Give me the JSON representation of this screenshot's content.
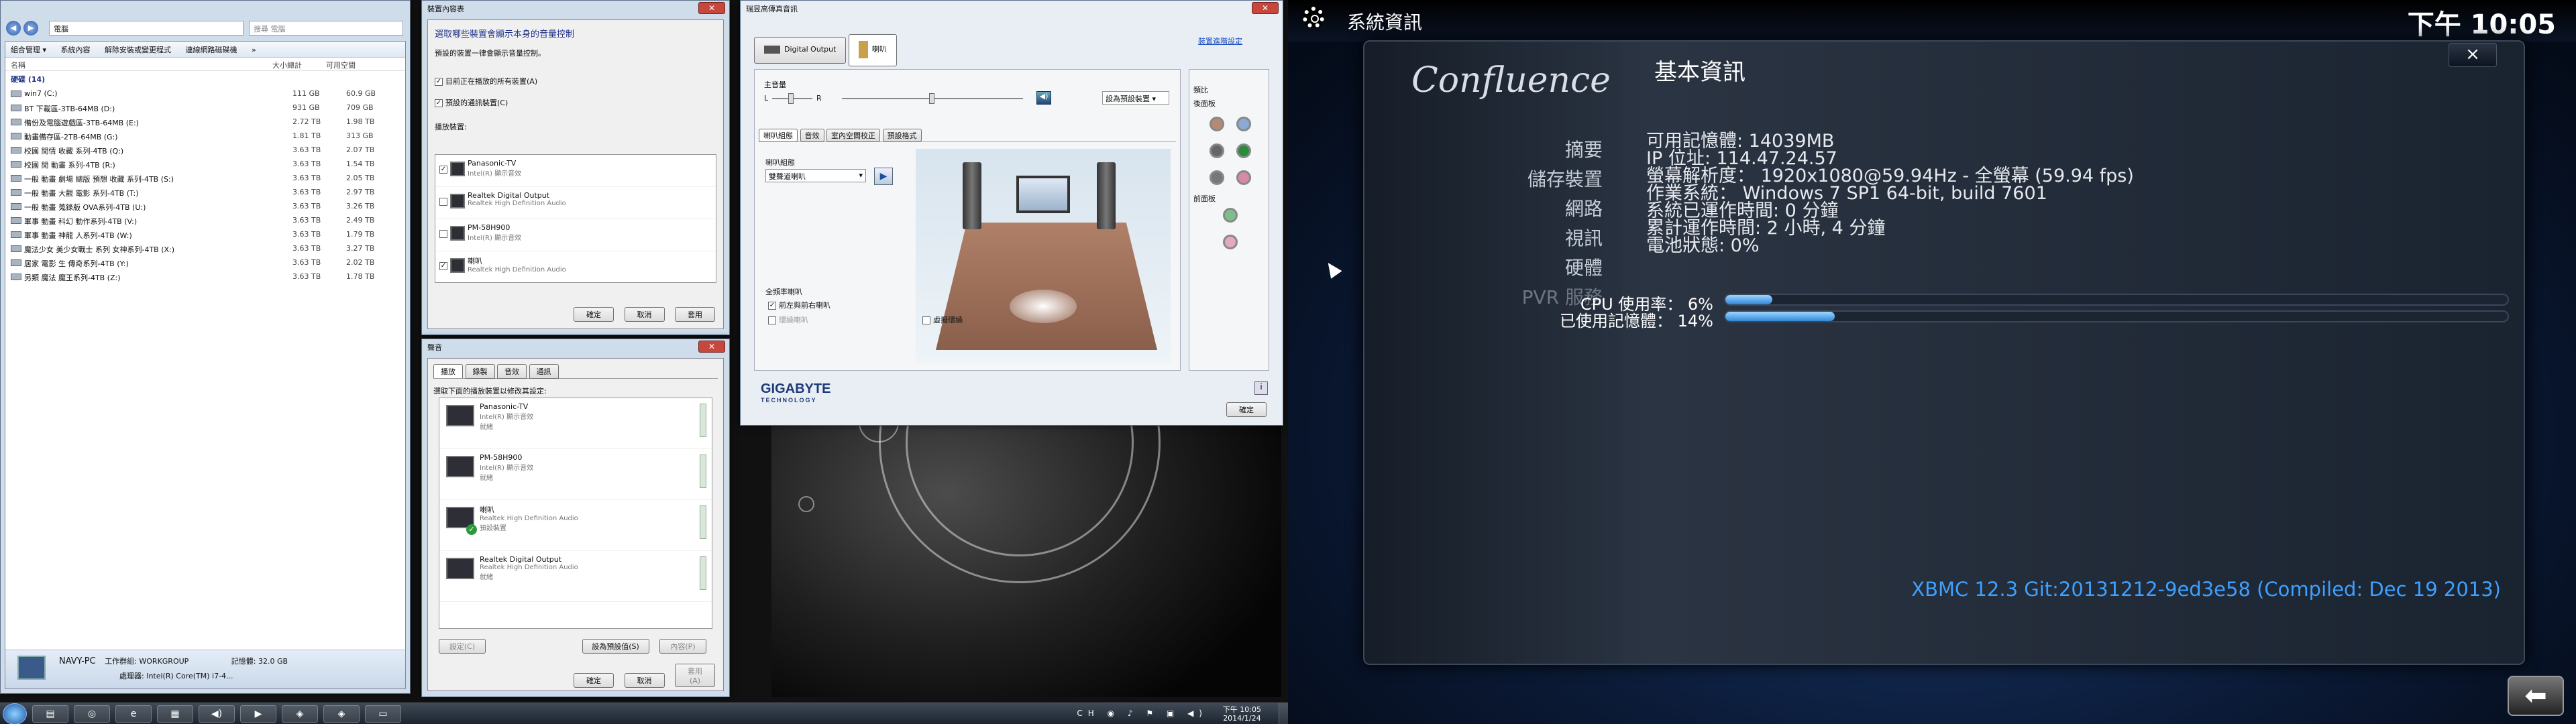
{
  "left": {
    "explorer": {
      "address": "電腦",
      "search_placeholder": "搜尋 電腦",
      "toolbar": [
        "組合管理 ▾",
        "系統內容",
        "解除安裝或變更程式",
        "連線網路磁碟機",
        "»"
      ],
      "columns": [
        "名稱",
        "大小總計",
        "可用空間"
      ],
      "group_label": "硬碟 (14)",
      "drives": [
        {
          "name": "win7 (C:)",
          "total": "111 GB",
          "free": "60.9 GB"
        },
        {
          "name": "BT 下載區-3TB-64MB (D:)",
          "total": "931 GB",
          "free": "709 GB"
        },
        {
          "name": "備份及電腦遊戲區-3TB-64MB (E:)",
          "total": "2.72 TB",
          "free": "1.98 TB"
        },
        {
          "name": "動畫備存區-2TB-64MB (G:)",
          "total": "1.81 TB",
          "free": "313 GB"
        },
        {
          "name": "校園 閒情 收藏 系列-4TB (Q:)",
          "total": "3.63 TB",
          "free": "2.07 TB"
        },
        {
          "name": "校園 閒 動畫 系列-4TB (R:)",
          "total": "3.63 TB",
          "free": "1.54 TB"
        },
        {
          "name": "一般 動畫 劇場 總版 預想 收藏 系列-4TB (S:)",
          "total": "3.63 TB",
          "free": "2.05 TB"
        },
        {
          "name": "一般 動畫 大觀 電影 系列-4TB (T:)",
          "total": "3.63 TB",
          "free": "2.97 TB"
        },
        {
          "name": "一般 動畫 蒐錄版 OVA系列-4TB (U:)",
          "total": "3.63 TB",
          "free": "3.26 TB"
        },
        {
          "name": "軍事 動畫 科幻 動作系列-4TB (V:)",
          "total": "3.63 TB",
          "free": "2.49 TB"
        },
        {
          "name": "軍事 動畫 神龍 人系列-4TB (W:)",
          "total": "3.63 TB",
          "free": "1.79 TB"
        },
        {
          "name": "魔法少女 美少女戰士 系列 女神系列-4TB (X:)",
          "total": "3.63 TB",
          "free": "3.27 TB"
        },
        {
          "name": "居家 電影 生 傳奇系列-4TB (Y:)",
          "total": "3.63 TB",
          "free": "2.02 TB"
        },
        {
          "name": "另類 魔法 魔王系列-4TB (Z:)",
          "total": "3.63 TB",
          "free": "1.78 TB"
        }
      ],
      "status_pc": "NAVY-PC",
      "status_workgroup": "工作群組: WORKGROUP",
      "status_memory": "記憶體: 32.0 GB",
      "status_cpu": "處理器: Intel(R) Core(TM) i7-4..."
    },
    "volmix": {
      "title": "裝置內容表",
      "heading": "選取哪些裝置會顯示本身的音量控制",
      "desc": "預設的裝置一律會顯示音量控制。",
      "check1": "目前正在播放的所有裝置(A)",
      "check2": "預設的通訊裝置(C)",
      "list_label": "播放裝置:",
      "devices": [
        {
          "name": "Panasonic-TV",
          "sub": "Intel(R) 顯示音效"
        },
        {
          "name": "Realtek Digital Output",
          "sub": "Realtek High Definition Audio"
        },
        {
          "name": "PM-58H900",
          "sub": "Intel(R) 顯示音效"
        },
        {
          "name": "喇叭",
          "sub": "Realtek High Definition Audio"
        }
      ],
      "buttons": [
        "確定",
        "取消",
        "套用"
      ]
    },
    "sound": {
      "title": "聲音",
      "tabs": [
        "播放",
        "錄製",
        "音效",
        "通訊"
      ],
      "desc": "選取下面的播放裝置以修改其設定:",
      "devices": [
        {
          "name": "Panasonic-TV",
          "sub": "Intel(R) 顯示音效",
          "state": "就緒"
        },
        {
          "name": "PM-58H900",
          "sub": "Intel(R) 顯示音效",
          "state": "就緒"
        },
        {
          "name": "喇叭",
          "sub": "Realtek High Definition Audio",
          "state": "預設裝置"
        },
        {
          "name": "Realtek Digital Output",
          "sub": "Realtek High Definition Audio",
          "state": "就緒"
        }
      ],
      "btn_config": "設定(C)",
      "btn_default": "設為預設值(S)",
      "btn_props": "內容(P)",
      "buttons": [
        "確定",
        "取消",
        "套用(A)"
      ]
    },
    "realtek": {
      "title": "瑞昱高傳真音訊",
      "tab_digital": "Digital Output",
      "tab_speakers": "喇叭",
      "link": "裝置進階設定",
      "main_volume": "主音量",
      "lr_left": "L",
      "lr_right": "R",
      "default_device": "設為預設裝置",
      "subtabs": [
        "喇叭組態",
        "音效",
        "室內空間校正",
        "預設格式"
      ],
      "config_label": "喇叭組態",
      "config_value": "雙聲道喇叭",
      "fullrange_label": "全頻率喇叭",
      "fullrange_front": "前左與前右喇叭",
      "fullrange_surround": "環繞喇叭",
      "virtual_surround": "虛擬環繞",
      "analog_label": "類比",
      "rear_panel": "後面板",
      "front_panel": "前面板",
      "brand": "GIGABYTE",
      "brand_sub": "TECHNOLOGY",
      "ok": "確定"
    },
    "taskbar": {
      "icons": [
        "explorer",
        "chrome",
        "ie",
        "folder",
        "sound",
        "wmp",
        "shield",
        "shield2",
        "network"
      ],
      "lang": "CH",
      "time": "下午 10:05",
      "date": "2014/1/24"
    }
  },
  "right": {
    "header_title": "系統資訊",
    "clock": "下午 10:05",
    "logo": "Confluence",
    "panel_title": "基本資訊",
    "close": "×",
    "menu": [
      "摘要",
      "儲存裝置",
      "網路",
      "視訊",
      "硬體",
      "PVR 服務"
    ],
    "info": [
      "可用記憶體: 14039MB",
      "IP 位址: 114.47.24.57",
      "螢幕解析度： 1920x1080@59.94Hz - 全螢幕 (59.94 fps)",
      "作業系統： Windows 7 SP1 64-bit, build 7601",
      "系統已運作時間: 0 分鐘",
      "累計運作時間: 2 小時, 4 分鐘",
      "電池狀態: 0%"
    ],
    "version": "XBMC 12.3 Git:20131212-9ed3e58 (Compiled: Dec 19 2013)",
    "cpu_label": "CPU 使用率： 6%",
    "cpu_value": 6,
    "mem_label": "已使用記憶體： 14%",
    "mem_value": 14
  }
}
